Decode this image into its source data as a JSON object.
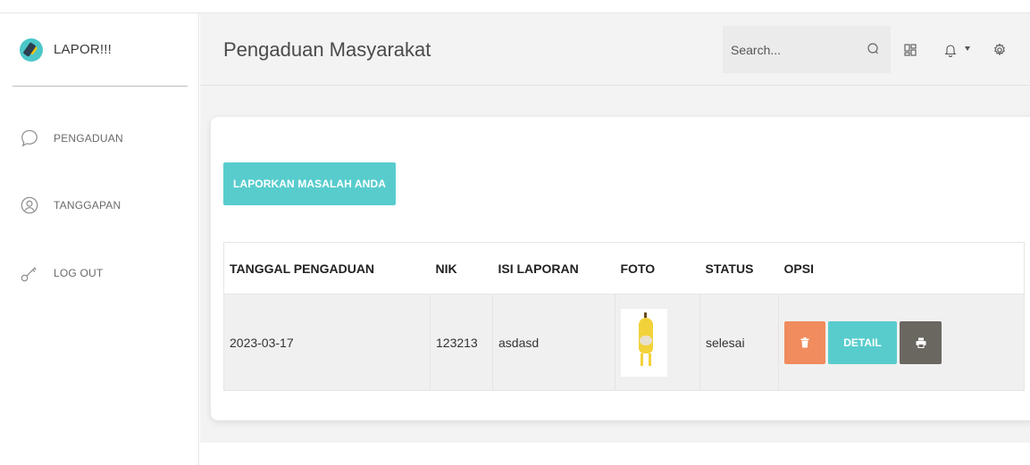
{
  "sidebar": {
    "brand": "LAPOR!!!",
    "items": [
      {
        "label": "PENGADUAN",
        "icon": "chat-bubble-icon"
      },
      {
        "label": "TANGGAPAN",
        "icon": "user-circle-icon"
      },
      {
        "label": "LOG OUT",
        "icon": "key-icon"
      }
    ]
  },
  "header": {
    "title": "Pengaduan Masyarakat",
    "search_placeholder": "Search..."
  },
  "main": {
    "report_button": "LAPORKAN MASALAH ANDA",
    "table": {
      "headers": [
        "TANGGAL PENGADUAN",
        "NIK",
        "ISI LAPORAN",
        "FOTO",
        "STATUS",
        "OPSI"
      ],
      "rows": [
        {
          "tanggal": "2023-03-17",
          "nik": "123213",
          "isi": "asdasd",
          "status": "selesai"
        }
      ],
      "detail_label": "DETAIL"
    }
  },
  "colors": {
    "accent": "#58cccd",
    "delete": "#f08c5e",
    "print": "#6a6660",
    "header_bg": "#f3f3f3"
  }
}
